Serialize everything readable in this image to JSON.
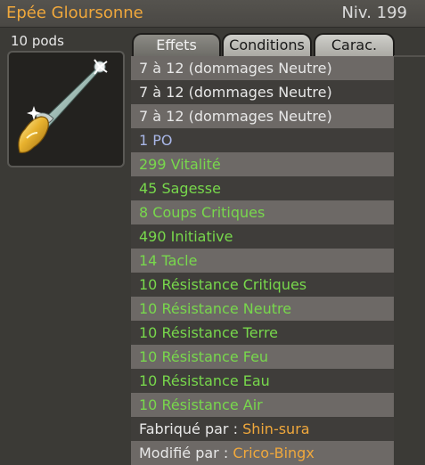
{
  "item": {
    "name": "Epée Gloursonne",
    "level": "Niv. 199",
    "weight": "10 pods"
  },
  "tabs": [
    {
      "label": "Effets",
      "active": true
    },
    {
      "label": "Conditions",
      "active": false
    },
    {
      "label": "Carac.",
      "active": false
    }
  ],
  "effects": [
    {
      "text": "7 à 12 (dommages Neutre)",
      "color": "#e8e8e8"
    },
    {
      "text": "7 à 12 (dommages Neutre)",
      "color": "#e8e8e8"
    },
    {
      "text": "7 à 12 (dommages Neutre)",
      "color": "#e8e8e8"
    },
    {
      "text": "1 PO",
      "color": "#a8b6e6"
    },
    {
      "text": "299 Vitalité",
      "color": "#78d84c"
    },
    {
      "text": "45 Sagesse",
      "color": "#78d84c"
    },
    {
      "text": "8 Coups Critiques",
      "color": "#78d84c"
    },
    {
      "text": "490 Initiative",
      "color": "#78d84c"
    },
    {
      "text": "14 Tacle",
      "color": "#78d84c"
    },
    {
      "text": "10 Résistance Critiques",
      "color": "#78d84c"
    },
    {
      "text": "10 Résistance Neutre",
      "color": "#78d84c"
    },
    {
      "text": "10 Résistance Terre",
      "color": "#78d84c"
    },
    {
      "text": "10 Résistance Feu",
      "color": "#78d84c"
    },
    {
      "text": "10 Résistance Eau",
      "color": "#78d84c"
    },
    {
      "text": "10 Résistance Air",
      "color": "#78d84c"
    }
  ],
  "crafted": {
    "label": "Fabriqué par :",
    "name": "Shin-sura"
  },
  "modified": {
    "label": "Modifié par :",
    "name": "Crico-Bingx"
  },
  "colors": {
    "title": "#f0a83c",
    "maker_name": "#f0a83c",
    "effect_neutral": "#e8e8e8",
    "effect_range": "#a8b6e6",
    "effect_stat": "#78d84c"
  },
  "icons": {
    "item_image": "sword-icon"
  }
}
